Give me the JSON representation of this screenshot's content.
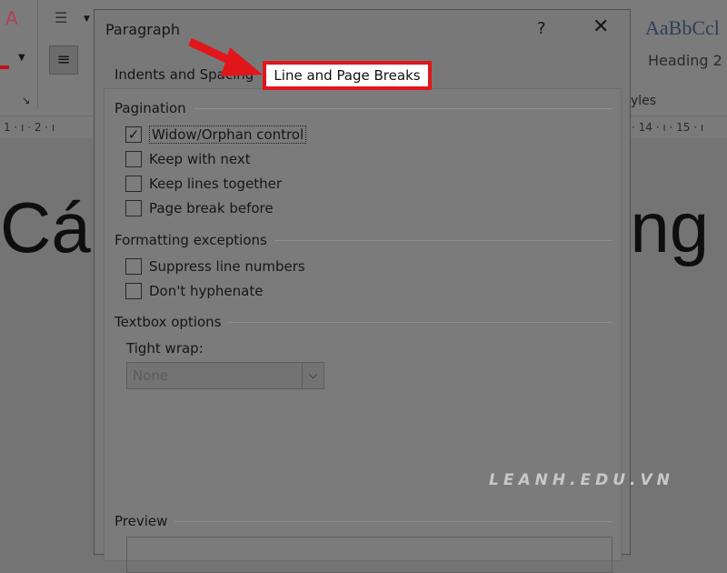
{
  "ribbon": {
    "style_preview": "AaBbCcl",
    "style_name": "Heading 2",
    "group_label": "yles"
  },
  "ruler": {
    "left": "1 · ı · 2 · ı",
    "right": "· 14 · ı · 15 · ı"
  },
  "document": {
    "text_left": "Các",
    "text_right": "ong"
  },
  "dialog": {
    "title": "Paragraph",
    "help": "?",
    "close": "✕",
    "tabs": [
      {
        "label": "Indents and Spacing",
        "active": false
      },
      {
        "label": "Line and Page Breaks",
        "active": true
      }
    ],
    "pagination": {
      "label": "Pagination",
      "items": [
        {
          "label": "Widow/Orphan control",
          "checked": true
        },
        {
          "label": "Keep with next",
          "checked": false
        },
        {
          "label": "Keep lines together",
          "checked": false
        },
        {
          "label": "Page break before",
          "checked": false
        }
      ]
    },
    "formatting": {
      "label": "Formatting exceptions",
      "items": [
        {
          "label": "Suppress line numbers",
          "checked": false
        },
        {
          "label": "Don't hyphenate",
          "checked": false
        }
      ]
    },
    "textbox": {
      "label": "Textbox options",
      "tight_wrap_label": "Tight wrap:",
      "tight_wrap_value": "None"
    },
    "preview": {
      "label": "Preview"
    }
  },
  "annotation": {
    "highlight_color": "#e0161b"
  },
  "watermark": "LEANH.EDU.VN"
}
